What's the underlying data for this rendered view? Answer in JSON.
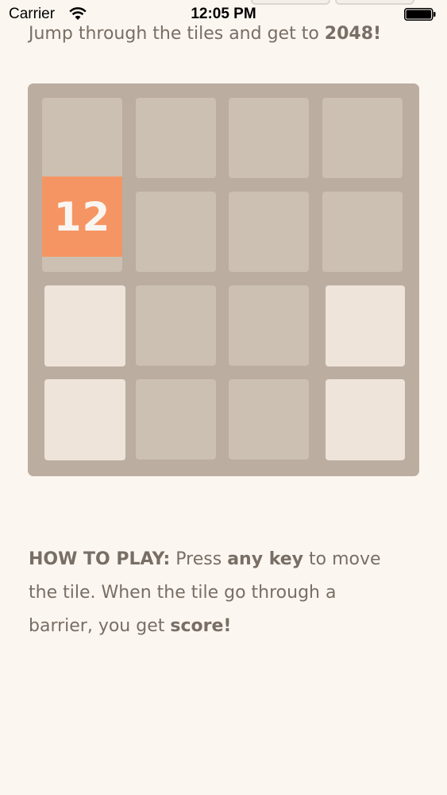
{
  "status_bar": {
    "carrier": "Carrier",
    "time": "12:05 PM"
  },
  "tagline": {
    "prefix": "Jump through the tiles and get to ",
    "highlight": "2048",
    "suffix": "!"
  },
  "board": {
    "moving_tile_value": "12",
    "light_cells": [
      "r3c1",
      "r3c4",
      "r4c1",
      "r4c4"
    ]
  },
  "instructions": {
    "heading": "HOW TO PLAY:",
    "part1": " Press ",
    "key_phrase": "any key",
    "part2": " to move the tile. When the tile go through a barrier, you get ",
    "score_word": "score!"
  },
  "colors": {
    "background": "#fcf6f0",
    "board": "#bbada0",
    "empty_cell": "#ccc0b3",
    "light_cell": "#eee4da",
    "moving_tile": "#f59563",
    "text": "#776e65"
  }
}
